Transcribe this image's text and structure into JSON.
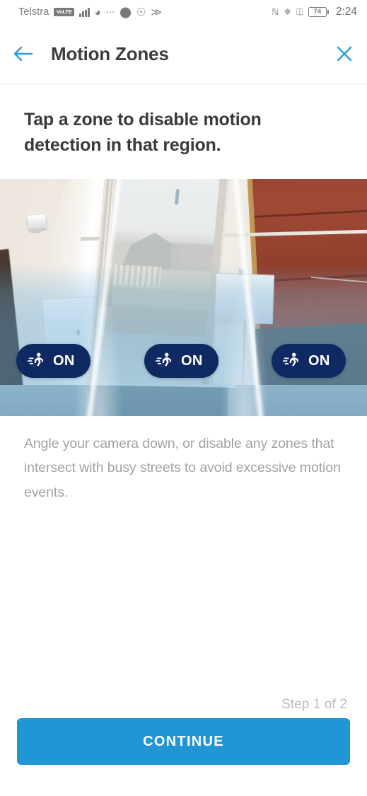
{
  "status_bar": {
    "carrier": "Telstra",
    "volte_badge": "VoLTE",
    "icons_left": [
      "signal-bars-icon",
      "wifi-icon",
      "glasses-icon",
      "chat-bubble-icon",
      "whatsapp-icon",
      "swiftkey-icon"
    ],
    "icons_right": [
      "nfc-icon",
      "bluetooth-icon",
      "vibrate-icon"
    ],
    "battery_percent": "74",
    "time": "2:24"
  },
  "header": {
    "back_icon": "arrow-left-icon",
    "title": "Motion Zones",
    "close_icon": "close-icon",
    "accent_color": "#2e9bd6"
  },
  "instruction": "Tap a zone to disable motion detection in that region.",
  "camera": {
    "zones": [
      {
        "id": "zone-left",
        "state_label": "ON",
        "icon": "running-person-icon",
        "enabled": true
      },
      {
        "id": "zone-center",
        "state_label": "ON",
        "icon": "running-person-icon",
        "enabled": true
      },
      {
        "id": "zone-right",
        "state_label": "ON",
        "icon": "running-person-icon",
        "enabled": true
      }
    ],
    "badge_color": "#0f2a63",
    "zone_tint_color": "#6cb2de"
  },
  "hint": "Angle your camera down, or disable any zones that intersect with busy streets to avoid excessive motion events.",
  "footer": {
    "step_text": "Step 1 of 2",
    "continue_label": "CONTINUE",
    "continue_color": "#2196d4"
  }
}
